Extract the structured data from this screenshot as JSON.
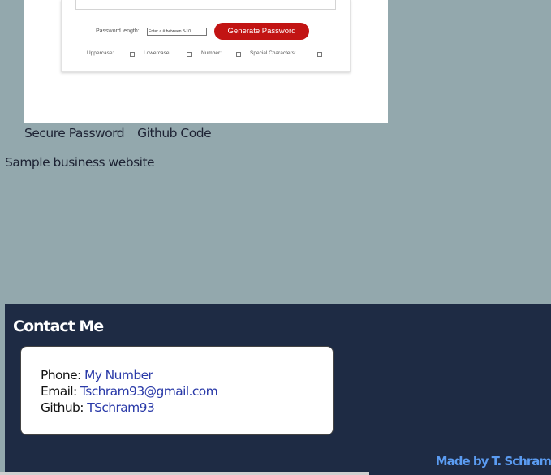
{
  "preview": {
    "length_label": "Password length:",
    "length_placeholder": "Enter a # between 8-10",
    "generate_label": "Generate Password",
    "options": {
      "uppercase": "Uppercase:",
      "lowercase": "Lowercase:",
      "number": "Number:",
      "special": "Special Characters:"
    }
  },
  "project_links": {
    "secure_password": "Secure Password",
    "github_code": "Github Code"
  },
  "sample_label": "Sample business website",
  "contact": {
    "title": "Contact Me",
    "phone_label": "Phone:",
    "phone_value": "My Number",
    "email_label": "Email:",
    "email_value": "Tschram93@gmail.com",
    "github_label": "Github:",
    "github_value": "TSchram93"
  },
  "footer": {
    "made_by": "Made by T. Schram"
  },
  "colors": {
    "page_bg": "#93a8ad",
    "contact_bg": "#1e2b44",
    "button_red": "#c21413",
    "link_blue": "#2a3aa8",
    "footer_link": "#5b9cf2"
  }
}
